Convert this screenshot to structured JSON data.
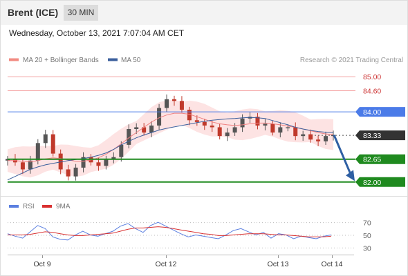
{
  "header": {
    "title": "Brent (ICE)",
    "timeframe": "30 MIN",
    "datetime": "Wednesday, October 13, 2021 7:07:04 AM CET"
  },
  "legend": {
    "items": [
      {
        "label": "MA 20 + Bollinger Bands",
        "color": "#f28b82"
      },
      {
        "label": "MA 50",
        "color": "#3b5f9c"
      }
    ],
    "credit": "Research © 2021 Trading Central"
  },
  "colors": {
    "up_candle": "#555555",
    "down_candle": "#c0392b",
    "bollinger_fill": "#fde3e3",
    "ma20": "#f08080",
    "ma50": "#3b5f9c",
    "pivot": "#4b7be8",
    "resistance": "#f4a0a0",
    "support": "#1f8a1f",
    "current": "#333333",
    "arrow": "#2e5fa3",
    "rsi": "#5b7fe0",
    "rsi_ma": "#d93030"
  },
  "chart_data": [
    {
      "type": "candlestick",
      "title": "Brent (ICE)",
      "ylim": [
        81.75,
        85.25
      ],
      "x_tick_labels": [
        "Oct 9",
        "Oct 12",
        "Oct 13",
        "Oct 14"
      ],
      "levels": [
        {
          "value": 85.0,
          "label": "85.00",
          "kind": "resistance"
        },
        {
          "value": 84.6,
          "label": "84.60",
          "kind": "resistance"
        },
        {
          "value": 84.0,
          "label": "84.00",
          "kind": "pivot"
        },
        {
          "value": 83.33,
          "label": "83.33",
          "kind": "current"
        },
        {
          "value": 82.65,
          "label": "82.65",
          "kind": "support"
        },
        {
          "value": 82.0,
          "label": "82.00",
          "kind": "support"
        }
      ],
      "forecast_arrow": {
        "from": 83.33,
        "to": 82.0
      },
      "series": [
        {
          "name": "Price",
          "values": [
            82.65,
            82.55,
            82.35,
            82.6,
            83.1,
            83.35,
            82.8,
            82.35,
            82.15,
            82.4,
            82.7,
            82.55,
            82.45,
            82.65,
            82.7,
            83.05,
            83.5,
            83.55,
            83.4,
            83.6,
            84.1,
            84.35,
            84.3,
            84.05,
            83.75,
            83.7,
            83.6,
            83.55,
            83.3,
            83.4,
            83.55,
            83.8,
            83.85,
            83.6,
            83.65,
            83.4,
            83.55,
            83.55,
            83.3,
            83.35,
            83.2,
            83.15,
            83.3,
            83.33
          ]
        },
        {
          "name": "MA 20",
          "values": [
            82.6,
            82.6,
            82.58,
            82.56,
            82.6,
            82.65,
            82.68,
            82.66,
            82.62,
            82.58,
            82.58,
            82.62,
            82.68,
            82.78,
            82.92,
            83.08,
            83.25,
            83.4,
            83.55,
            83.7,
            83.82,
            83.9,
            83.95,
            83.95,
            83.92,
            83.85,
            83.78,
            83.7,
            83.65,
            83.62,
            83.6,
            83.62,
            83.65,
            83.67,
            83.67,
            83.65,
            83.62,
            83.58,
            83.55,
            83.5,
            83.45,
            83.4,
            83.36,
            83.34
          ]
        },
        {
          "name": "MA 50",
          "values": [
            82.05,
            82.15,
            82.25,
            82.35,
            82.42,
            82.48,
            82.52,
            82.56,
            82.6,
            82.63,
            82.66,
            82.7,
            82.75,
            82.82,
            82.92,
            83.05,
            83.15,
            83.25,
            83.33,
            83.4,
            83.47,
            83.52,
            83.56,
            83.6,
            83.64,
            83.68,
            83.72,
            83.75,
            83.77,
            83.79,
            83.8,
            83.82,
            83.83,
            83.82,
            83.8,
            83.74,
            83.68,
            83.62,
            83.55,
            83.5,
            83.46,
            83.43,
            83.41,
            83.4
          ]
        }
      ]
    },
    {
      "type": "line",
      "title": "RSI",
      "ylim": [
        20,
        80
      ],
      "y_tick_labels": [
        "70",
        "50",
        "30"
      ],
      "y_ticks": [
        70,
        50,
        30
      ],
      "series": [
        {
          "name": "RSI",
          "values": [
            52,
            48,
            45,
            55,
            65,
            60,
            47,
            43,
            42,
            50,
            56,
            50,
            48,
            52,
            56,
            64,
            68,
            60,
            54,
            65,
            70,
            64,
            58,
            52,
            47,
            50,
            48,
            46,
            44,
            50,
            57,
            60,
            55,
            50,
            54,
            45,
            52,
            50,
            44,
            48,
            46,
            44,
            48,
            50
          ]
        },
        {
          "name": "9MA",
          "values": [
            50,
            50,
            50,
            51,
            53,
            55,
            54,
            52,
            50,
            49,
            49,
            50,
            51,
            52,
            53,
            56,
            59,
            61,
            61,
            62,
            63,
            62,
            60,
            58,
            56,
            54,
            52,
            51,
            49,
            49,
            50,
            51,
            52,
            52,
            52,
            51,
            50,
            50,
            49,
            48,
            47,
            47,
            47,
            48
          ]
        }
      ]
    }
  ],
  "rsi_legend": [
    {
      "label": "RSI",
      "color": "#5b7fe0"
    },
    {
      "label": "9MA",
      "color": "#d93030"
    }
  ]
}
